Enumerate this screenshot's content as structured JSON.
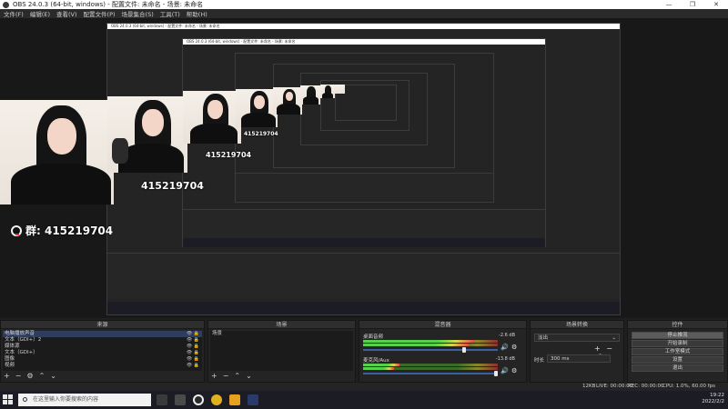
{
  "window": {
    "title": "OBS 24.0.3 (64-bit, windows) - 配置文件: 未命名 - 场景: 未命名",
    "controls": [
      "—",
      "❐",
      "✕"
    ]
  },
  "menu": [
    "文件(F)",
    "编辑(E)",
    "查看(V)",
    "配置文件(P)",
    "场景集合(S)",
    "工具(T)",
    "帮助(H)"
  ],
  "overlay": {
    "cam_number": "415219704",
    "group_text": "群: 415219704"
  },
  "docks": {
    "sources": {
      "header": "来源",
      "items": [
        "电脑播放声音",
        "文本（GDI+）2",
        "媒体源",
        "文本（GDI+）",
        "图像",
        "视频"
      ]
    },
    "scenes": {
      "header": "场景",
      "items": [
        "场景"
      ]
    },
    "mixer": {
      "header": "混音器",
      "channels": [
        {
          "name": "桌面音频",
          "db": "-2.6 dB"
        },
        {
          "name": "麦克风/Aux",
          "db": "-13.8 dB"
        }
      ]
    },
    "transitions": {
      "header": "场景转换",
      "selected": "淡出",
      "duration_label": "时长",
      "duration_value": "300 ms"
    },
    "controls": {
      "header": "控件",
      "buttons": [
        "停止推流",
        "开始录制",
        "工作室模式",
        "设置",
        "退出"
      ]
    }
  },
  "status": {
    "live": "LIVE: 00:00:00",
    "rec": "REC: 00:00:00",
    "cpu": "CPU: 1.0%, 60.00 fps",
    "dropped": "12KB"
  },
  "taskbar": {
    "search_placeholder": "在这里输入你要搜索的内容",
    "time": "19:22",
    "date": "2022/2/2"
  },
  "colors": {
    "accent": "#2f3d5c",
    "meter_green": "#55d24a",
    "meter_yellow": "#d8d84a",
    "meter_red": "#e04a4a"
  }
}
